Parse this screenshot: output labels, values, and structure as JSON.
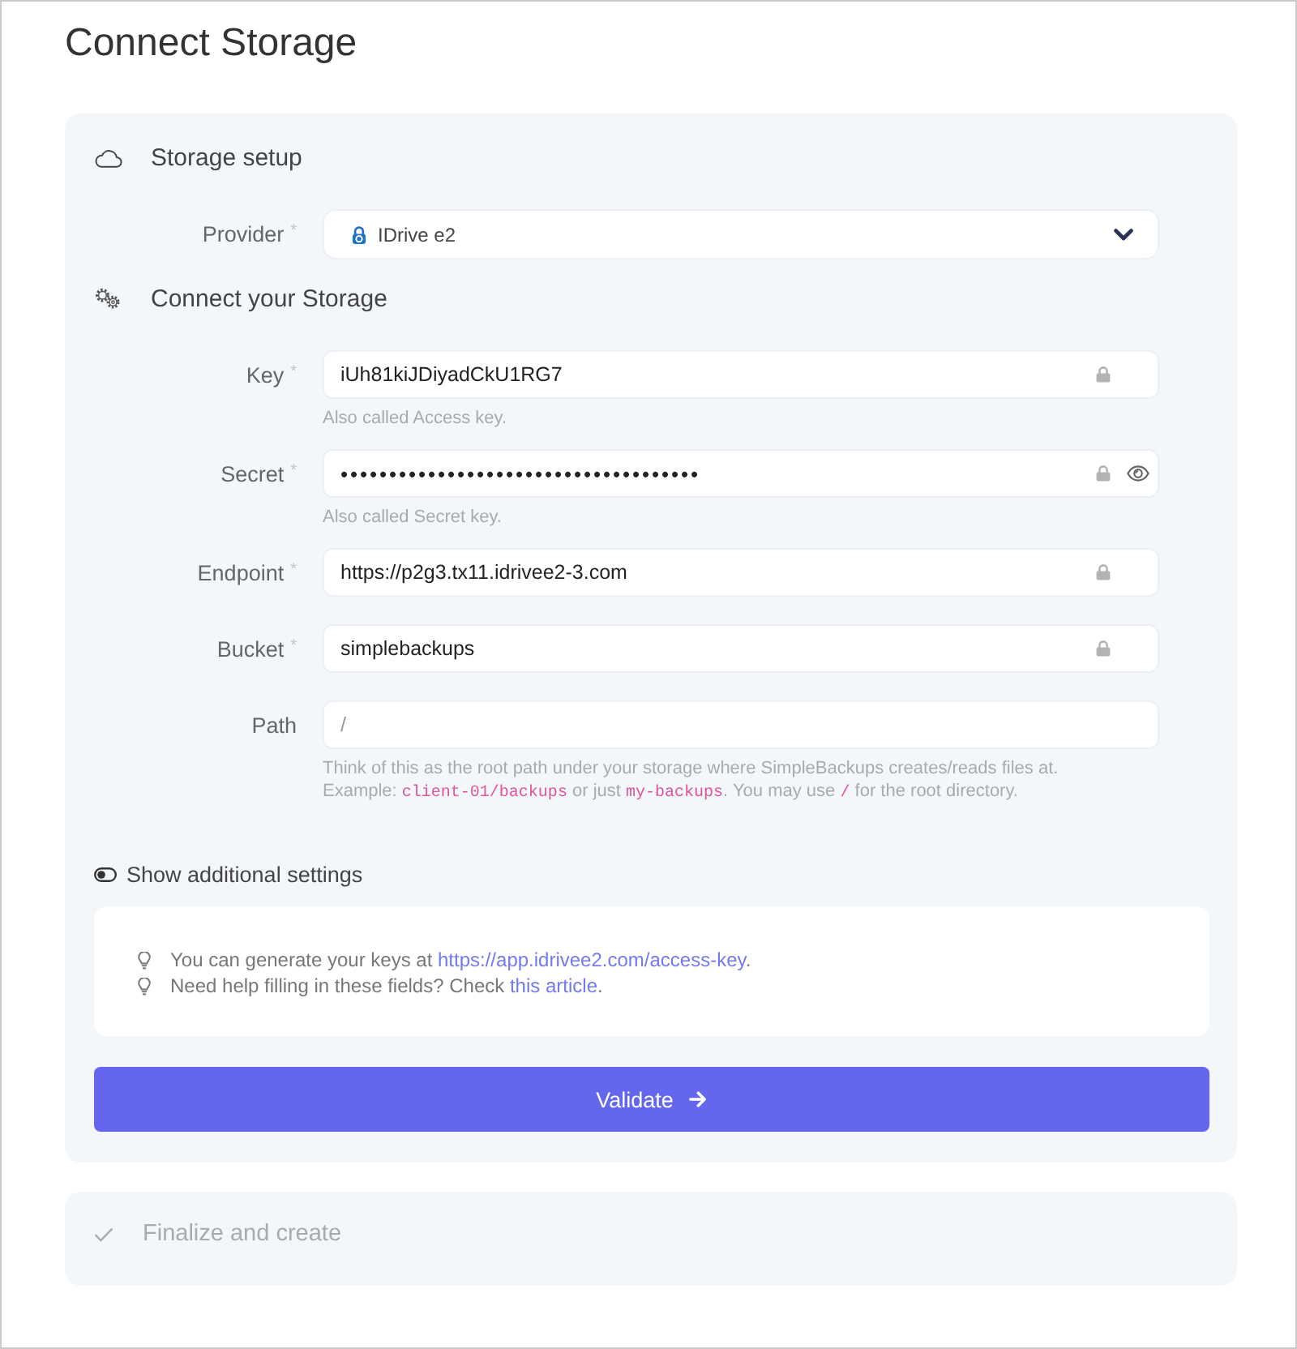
{
  "title": "Connect Storage",
  "setup": {
    "heading": "Storage setup",
    "provider": {
      "label": "Provider",
      "required_mark": "*",
      "value": "IDrive e2"
    }
  },
  "connect": {
    "heading": "Connect your Storage",
    "fields": [
      {
        "label": "Key",
        "required_mark": "*",
        "value": "iUh81kiJDiyadCkU1RG7",
        "masked": false,
        "locked": true,
        "revealable": false,
        "help": [
          [
            {
              "kind": "text",
              "text": "Also called Access key."
            }
          ]
        ]
      },
      {
        "label": "Secret",
        "required_mark": "*",
        "value": "•••••••••••••••••••••••••••••••••••••",
        "masked": true,
        "locked": true,
        "revealable": true,
        "help": [
          [
            {
              "kind": "text",
              "text": "Also called Secret key."
            }
          ]
        ]
      },
      {
        "label": "Endpoint",
        "required_mark": "*",
        "value": "https://p2g3.tx11.idrivee2-3.com",
        "masked": false,
        "locked": true,
        "revealable": false
      },
      {
        "label": "Bucket",
        "required_mark": "*",
        "value": "simplebackups",
        "masked": false,
        "locked": true,
        "revealable": false
      },
      {
        "label": "Path",
        "placeholder": "/",
        "masked": false,
        "locked": false,
        "revealable": false,
        "help": [
          [
            {
              "kind": "text",
              "text": "Think of this as the root path under your storage where SimpleBackups creates/reads files at."
            }
          ],
          [
            {
              "kind": "text",
              "text": "Example: "
            },
            {
              "kind": "code",
              "text": "client-01/backups"
            },
            {
              "kind": "text",
              "text": " or just "
            },
            {
              "kind": "code",
              "text": "my-backups"
            },
            {
              "kind": "text",
              "text": ". You may use "
            },
            {
              "kind": "code",
              "text": "/"
            },
            {
              "kind": "text",
              "text": " for the root directory."
            }
          ]
        ]
      }
    ]
  },
  "additional_settings": {
    "label": "Show additional settings",
    "on": false
  },
  "tips": [
    [
      {
        "kind": "text",
        "text": "You can generate your keys at "
      },
      {
        "kind": "link",
        "text": "https://app.idrivee2.com/access-key"
      },
      {
        "kind": "text",
        "text": "."
      }
    ],
    [
      {
        "kind": "text",
        "text": "Need help filling in these fields? Check "
      },
      {
        "kind": "link",
        "text": "this article"
      },
      {
        "kind": "text",
        "text": "."
      }
    ]
  ],
  "validate_button": {
    "label": "Validate"
  },
  "finalize_step": {
    "label": "Finalize and create",
    "active": false
  }
}
